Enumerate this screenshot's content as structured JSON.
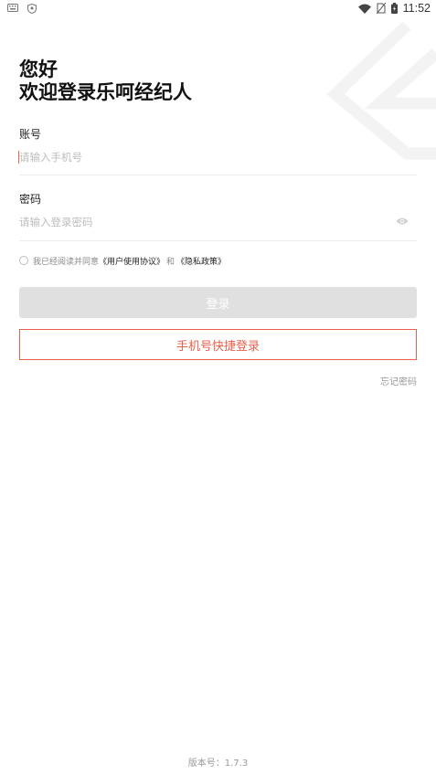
{
  "status_bar": {
    "time": "11:52",
    "icons": [
      "keyboard-icon",
      "shield-icon",
      "wifi-icon",
      "no-sim-icon",
      "battery-icon"
    ]
  },
  "greeting": {
    "line1": "您好",
    "line2": "欢迎登录乐呵经纪人"
  },
  "account": {
    "label": "账号",
    "placeholder": "请输入手机号"
  },
  "password": {
    "label": "密码",
    "placeholder": "请输入登录密码"
  },
  "agreement": {
    "prefix": "我已经阅读并同意",
    "user_agreement": "《用户使用协议》",
    "conjunction": "和",
    "privacy_policy": "《隐私政策》",
    "checked": false
  },
  "buttons": {
    "login_label": "登录",
    "quick_login_label": "手机号快捷登录",
    "forgot_password": "忘记密码"
  },
  "footer": {
    "version": "版本号：1.7.3"
  },
  "colors": {
    "accent": "#e8604a",
    "login_button_disabled": "#e0e0e0",
    "placeholder": "#bdbdbd",
    "divider": "#ececec"
  }
}
